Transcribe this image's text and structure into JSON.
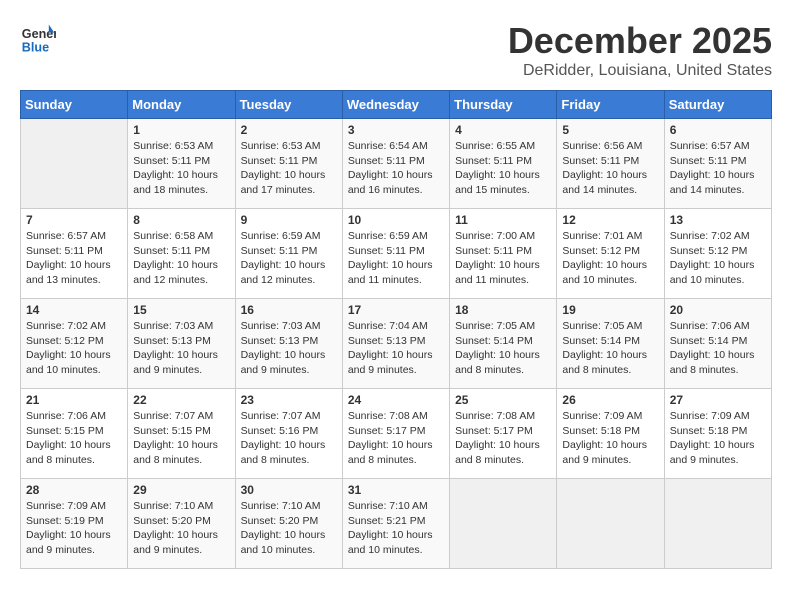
{
  "header": {
    "logo_line1": "General",
    "logo_line2": "Blue",
    "month": "December 2025",
    "location": "DeRidder, Louisiana, United States"
  },
  "days_of_week": [
    "Sunday",
    "Monday",
    "Tuesday",
    "Wednesday",
    "Thursday",
    "Friday",
    "Saturday"
  ],
  "weeks": [
    [
      {
        "num": "",
        "empty": true
      },
      {
        "num": "1",
        "sunrise": "6:53 AM",
        "sunset": "5:11 PM",
        "daylight": "10 hours and 18 minutes."
      },
      {
        "num": "2",
        "sunrise": "6:53 AM",
        "sunset": "5:11 PM",
        "daylight": "10 hours and 17 minutes."
      },
      {
        "num": "3",
        "sunrise": "6:54 AM",
        "sunset": "5:11 PM",
        "daylight": "10 hours and 16 minutes."
      },
      {
        "num": "4",
        "sunrise": "6:55 AM",
        "sunset": "5:11 PM",
        "daylight": "10 hours and 15 minutes."
      },
      {
        "num": "5",
        "sunrise": "6:56 AM",
        "sunset": "5:11 PM",
        "daylight": "10 hours and 14 minutes."
      },
      {
        "num": "6",
        "sunrise": "6:57 AM",
        "sunset": "5:11 PM",
        "daylight": "10 hours and 14 minutes."
      }
    ],
    [
      {
        "num": "7",
        "sunrise": "6:57 AM",
        "sunset": "5:11 PM",
        "daylight": "10 hours and 13 minutes."
      },
      {
        "num": "8",
        "sunrise": "6:58 AM",
        "sunset": "5:11 PM",
        "daylight": "10 hours and 12 minutes."
      },
      {
        "num": "9",
        "sunrise": "6:59 AM",
        "sunset": "5:11 PM",
        "daylight": "10 hours and 12 minutes."
      },
      {
        "num": "10",
        "sunrise": "6:59 AM",
        "sunset": "5:11 PM",
        "daylight": "10 hours and 11 minutes."
      },
      {
        "num": "11",
        "sunrise": "7:00 AM",
        "sunset": "5:11 PM",
        "daylight": "10 hours and 11 minutes."
      },
      {
        "num": "12",
        "sunrise": "7:01 AM",
        "sunset": "5:12 PM",
        "daylight": "10 hours and 10 minutes."
      },
      {
        "num": "13",
        "sunrise": "7:02 AM",
        "sunset": "5:12 PM",
        "daylight": "10 hours and 10 minutes."
      }
    ],
    [
      {
        "num": "14",
        "sunrise": "7:02 AM",
        "sunset": "5:12 PM",
        "daylight": "10 hours and 10 minutes."
      },
      {
        "num": "15",
        "sunrise": "7:03 AM",
        "sunset": "5:13 PM",
        "daylight": "10 hours and 9 minutes."
      },
      {
        "num": "16",
        "sunrise": "7:03 AM",
        "sunset": "5:13 PM",
        "daylight": "10 hours and 9 minutes."
      },
      {
        "num": "17",
        "sunrise": "7:04 AM",
        "sunset": "5:13 PM",
        "daylight": "10 hours and 9 minutes."
      },
      {
        "num": "18",
        "sunrise": "7:05 AM",
        "sunset": "5:14 PM",
        "daylight": "10 hours and 8 minutes."
      },
      {
        "num": "19",
        "sunrise": "7:05 AM",
        "sunset": "5:14 PM",
        "daylight": "10 hours and 8 minutes."
      },
      {
        "num": "20",
        "sunrise": "7:06 AM",
        "sunset": "5:14 PM",
        "daylight": "10 hours and 8 minutes."
      }
    ],
    [
      {
        "num": "21",
        "sunrise": "7:06 AM",
        "sunset": "5:15 PM",
        "daylight": "10 hours and 8 minutes."
      },
      {
        "num": "22",
        "sunrise": "7:07 AM",
        "sunset": "5:15 PM",
        "daylight": "10 hours and 8 minutes."
      },
      {
        "num": "23",
        "sunrise": "7:07 AM",
        "sunset": "5:16 PM",
        "daylight": "10 hours and 8 minutes."
      },
      {
        "num": "24",
        "sunrise": "7:08 AM",
        "sunset": "5:17 PM",
        "daylight": "10 hours and 8 minutes."
      },
      {
        "num": "25",
        "sunrise": "7:08 AM",
        "sunset": "5:17 PM",
        "daylight": "10 hours and 8 minutes."
      },
      {
        "num": "26",
        "sunrise": "7:09 AM",
        "sunset": "5:18 PM",
        "daylight": "10 hours and 9 minutes."
      },
      {
        "num": "27",
        "sunrise": "7:09 AM",
        "sunset": "5:18 PM",
        "daylight": "10 hours and 9 minutes."
      }
    ],
    [
      {
        "num": "28",
        "sunrise": "7:09 AM",
        "sunset": "5:19 PM",
        "daylight": "10 hours and 9 minutes."
      },
      {
        "num": "29",
        "sunrise": "7:10 AM",
        "sunset": "5:20 PM",
        "daylight": "10 hours and 9 minutes."
      },
      {
        "num": "30",
        "sunrise": "7:10 AM",
        "sunset": "5:20 PM",
        "daylight": "10 hours and 10 minutes."
      },
      {
        "num": "31",
        "sunrise": "7:10 AM",
        "sunset": "5:21 PM",
        "daylight": "10 hours and 10 minutes."
      },
      {
        "num": "",
        "empty": true
      },
      {
        "num": "",
        "empty": true
      },
      {
        "num": "",
        "empty": true
      }
    ]
  ]
}
